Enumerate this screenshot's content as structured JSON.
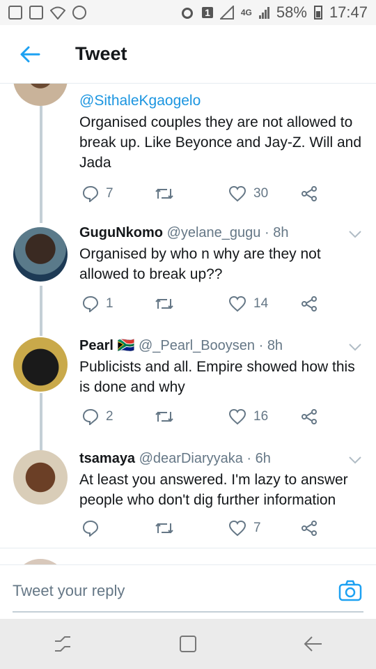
{
  "status_bar": {
    "battery": "58%",
    "time": "17:47",
    "network": "4G",
    "sim_badge": "1",
    "left_icons": [
      "checkbox-icon",
      "image-icon",
      "wifi-icon",
      "target-icon"
    ],
    "right_icons": [
      "alarm-icon",
      "sim-icon",
      "signal-icon",
      "battery-icon"
    ]
  },
  "header": {
    "title": "Tweet",
    "back_icon": "back-arrow-icon"
  },
  "tweets": [
    {
      "name": "",
      "handle": "",
      "reply_to": "@SithaleKgaogelo",
      "text": "Organised couples they are not allowed to break up. Like Beyonce and Jay-Z. Will and Jada",
      "replies": "7",
      "retweets": "",
      "likes": "30"
    },
    {
      "name": "GuguNkomo",
      "handle": "@yelane_gugu · 8h",
      "text": "Organised by who n why are they not allowed to break up??",
      "replies": "1",
      "retweets": "",
      "likes": "14"
    },
    {
      "name": "Pearl",
      "flag": "🇿🇦",
      "handle": "@_Pearl_Booysen · 8h",
      "text": "Publicists and all. Empire showed how this is done and why",
      "replies": "2",
      "retweets": "",
      "likes": "16"
    },
    {
      "name": "tsamaya",
      "handle": "@dearDiaryyaka · 6h",
      "text": "At least you answered. I'm lazy to answer people who don't dig further information",
      "replies": "",
      "retweets": "",
      "likes": "7"
    }
  ],
  "reply_bar": {
    "placeholder": "Tweet your reply",
    "camera_icon": "camera-icon"
  },
  "nav_bar": {
    "icons": [
      "recent-apps-icon",
      "home-icon",
      "back-icon"
    ]
  },
  "colors": {
    "accent": "#1da1f2",
    "muted": "#657786",
    "thread": "#c4cfd6"
  }
}
